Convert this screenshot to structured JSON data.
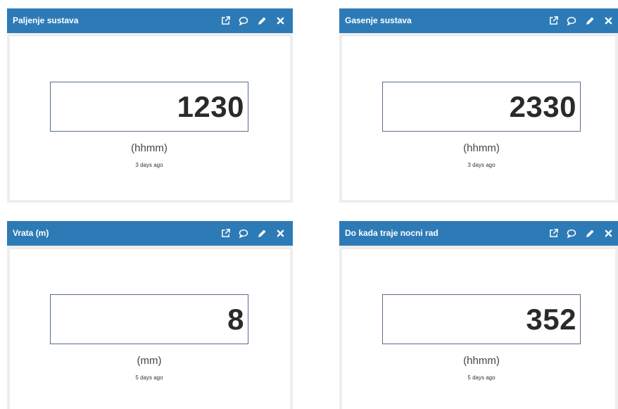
{
  "colors": {
    "header": "#2d7bb6",
    "panel_bg": "#eeeeee",
    "value_border": "#5a6e88"
  },
  "action_icons": [
    "external-link-icon",
    "comment-icon",
    "pencil-icon",
    "close-icon"
  ],
  "widgets": [
    {
      "title": "Paljenje sustava",
      "value": "1230",
      "unit": "(hhmm)",
      "time": "3 days ago"
    },
    {
      "title": "Gasenje sustava",
      "value": "2330",
      "unit": "(hhmm)",
      "time": "3 days ago"
    },
    {
      "title": "Vrata (m)",
      "value": "8",
      "unit": "(mm)",
      "time": "5 days ago"
    },
    {
      "title": "Do kada traje nocni rad",
      "value": "352",
      "unit": "(hhmm)",
      "time": "5 days ago"
    }
  ]
}
